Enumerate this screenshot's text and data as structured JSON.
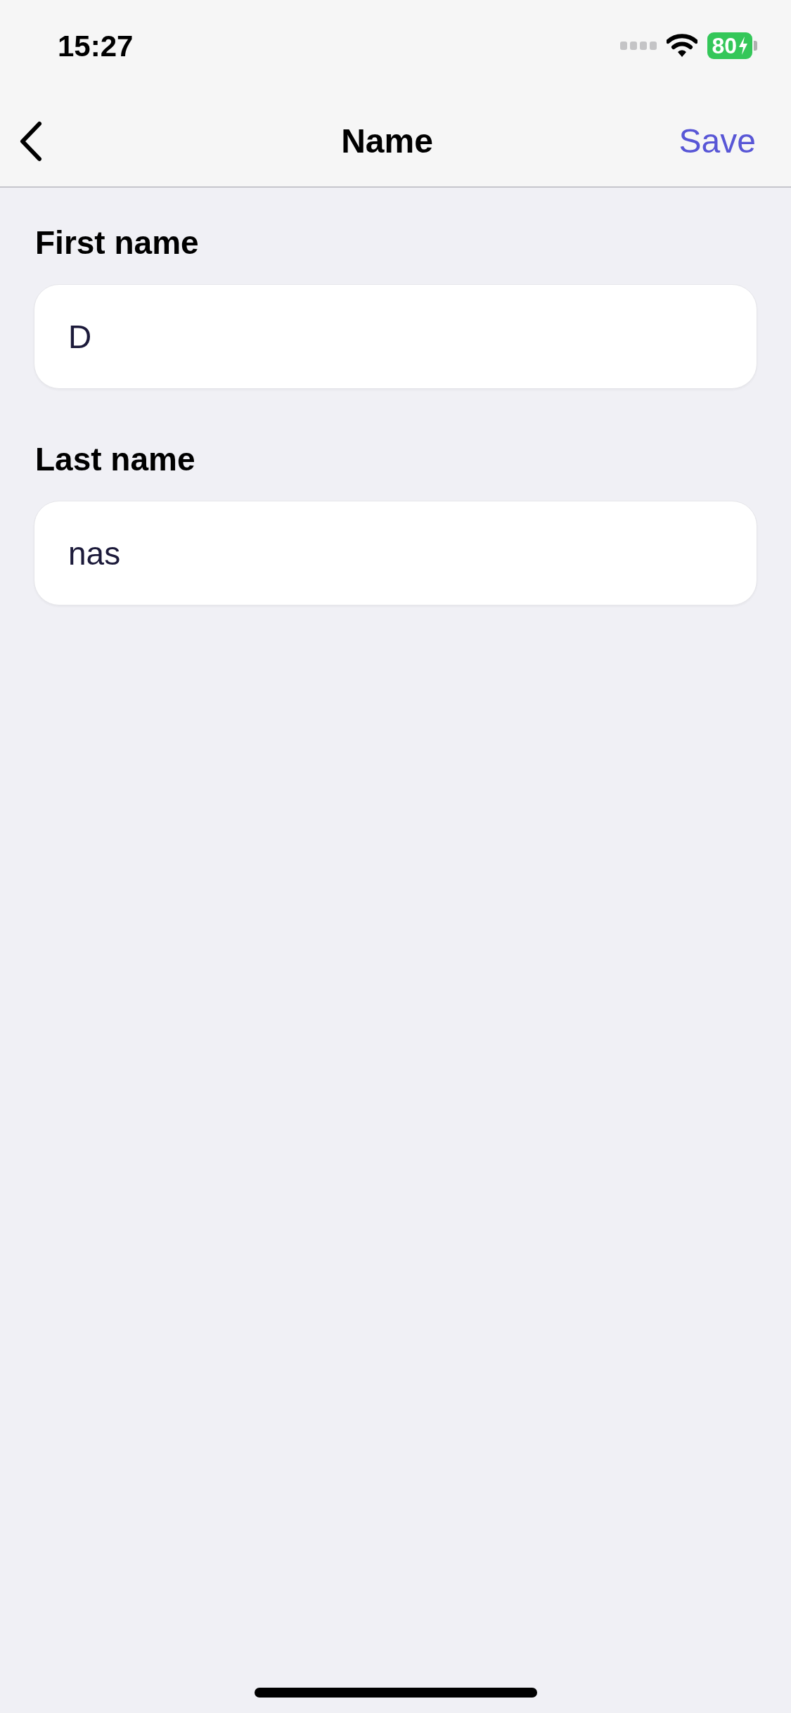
{
  "status_bar": {
    "time": "15:27",
    "battery": "80"
  },
  "nav_bar": {
    "title": "Name",
    "action": "Save"
  },
  "fields": [
    {
      "label": "First name",
      "value": "D"
    },
    {
      "label": "Last name",
      "value": "nas"
    }
  ]
}
